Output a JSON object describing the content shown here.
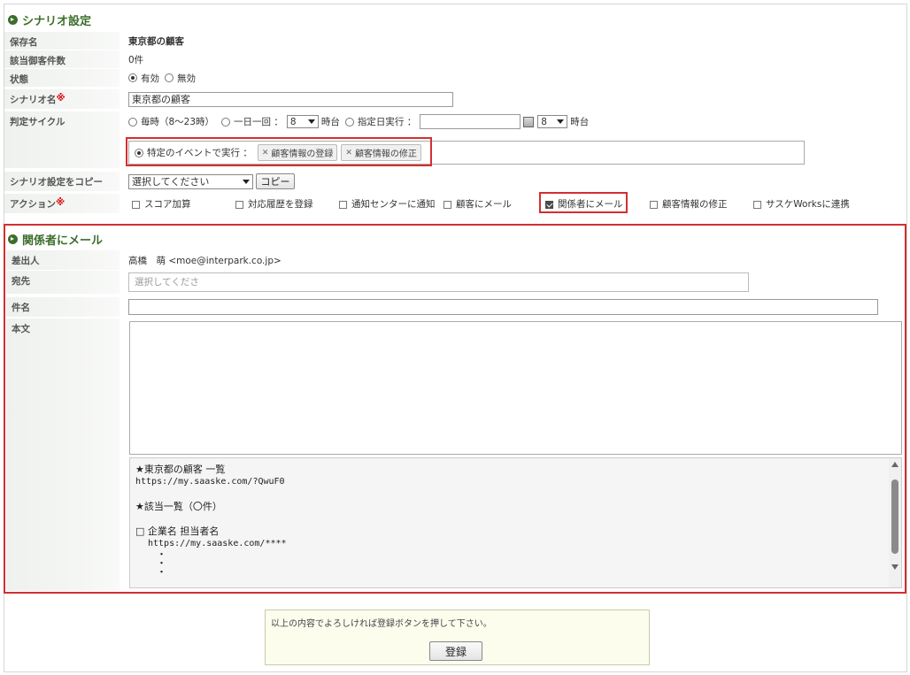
{
  "scenario": {
    "section_title": "シナリオ設定",
    "save_name": {
      "label": "保存名",
      "value": "東京都の顧客"
    },
    "count": {
      "label": "該当御客件数",
      "value": "0件"
    },
    "status": {
      "label": "状態",
      "opt_on": "有効",
      "opt_off": "無効"
    },
    "scenario_name": {
      "label": "シナリオ名",
      "req": "※",
      "value": "東京都の顧客"
    },
    "cycle": {
      "label": "判定サイクル",
      "opt_hourly": "毎時（8～23時）",
      "opt_daily": "一日一回 ：",
      "daily_hour": "8",
      "hour_suffix": "時台",
      "opt_date": "指定日実行 ：",
      "date_hour": "8",
      "hour_suffix2": "時台",
      "opt_event": "特定のイベントで実行 ：",
      "event_tags": [
        "顧客情報の登録",
        "顧客情報の修正"
      ]
    },
    "copy": {
      "label": "シナリオ設定をコピー",
      "select": "選択してください",
      "button": "コピー"
    },
    "action": {
      "label": "アクション",
      "req": "※",
      "items": [
        "スコア加算",
        "対応履歴を登録",
        "通知センターに通知",
        "顧客にメール",
        "関係者にメール",
        "顧客情報の修正",
        "サスケWorksに連携"
      ]
    }
  },
  "mail": {
    "section_title": "関係者にメール",
    "from": {
      "label": "差出人",
      "value": "高橋　萌 <moe@interpark.co.jp>"
    },
    "to": {
      "label": "宛先",
      "placeholder": "選択してくださ"
    },
    "subject": {
      "label": "件名",
      "value": ""
    },
    "body": {
      "label": "本文"
    },
    "template": {
      "line1": "★東京都の顧客 一覧",
      "line2": "https://my.saaske.com/?QwuF0",
      "line3": "★該当一覧（〇件）",
      "line4": "□ 企業名 担当者名",
      "line5": "https://my.saaske.com/****",
      "dot": "・"
    }
  },
  "footer": {
    "message": "以上の内容でよろしければ登録ボタンを押して下さい。",
    "submit": "登録"
  }
}
